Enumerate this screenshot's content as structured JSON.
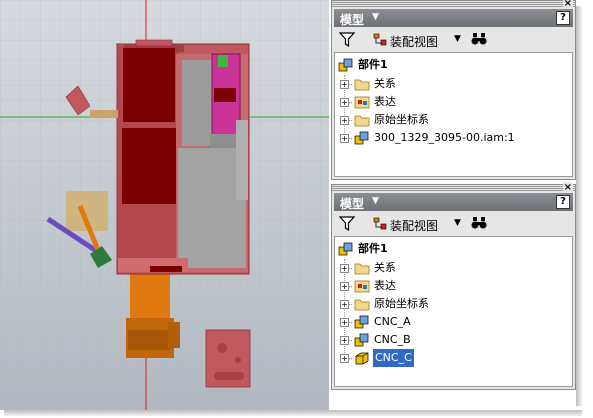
{
  "panels": [
    {
      "title": "模型",
      "toolbar": {
        "view_label": "装配视图"
      },
      "tree": {
        "root": "部件1",
        "items": [
          "关系",
          "表达",
          "原始坐标系",
          "300_1329_3095-00.iam:1"
        ]
      }
    },
    {
      "title": "模型",
      "toolbar": {
        "view_label": "装配视图"
      },
      "tree": {
        "root": "部件1",
        "items": [
          "关系",
          "表达",
          "原始坐标系",
          "CNC_A",
          "CNC_B",
          "CNC_C"
        ],
        "selected": "CNC_C"
      }
    }
  ],
  "panel_close": "×",
  "help_glyph": "?",
  "colors": {
    "model_red": "#c0585e",
    "dark_red": "#7a0000",
    "orange": "#e07a10",
    "magenta": "#cc3399",
    "gray_part": "#9c9c9c",
    "axis_red": "#d02020",
    "axis_green": "#20b020",
    "selection": "#316ac5"
  },
  "icons": [
    "filter-icon",
    "assembly-view-icon",
    "binoculars-icon",
    "assembly-icon",
    "folder-icon",
    "representation-icon",
    "part-icon"
  ]
}
